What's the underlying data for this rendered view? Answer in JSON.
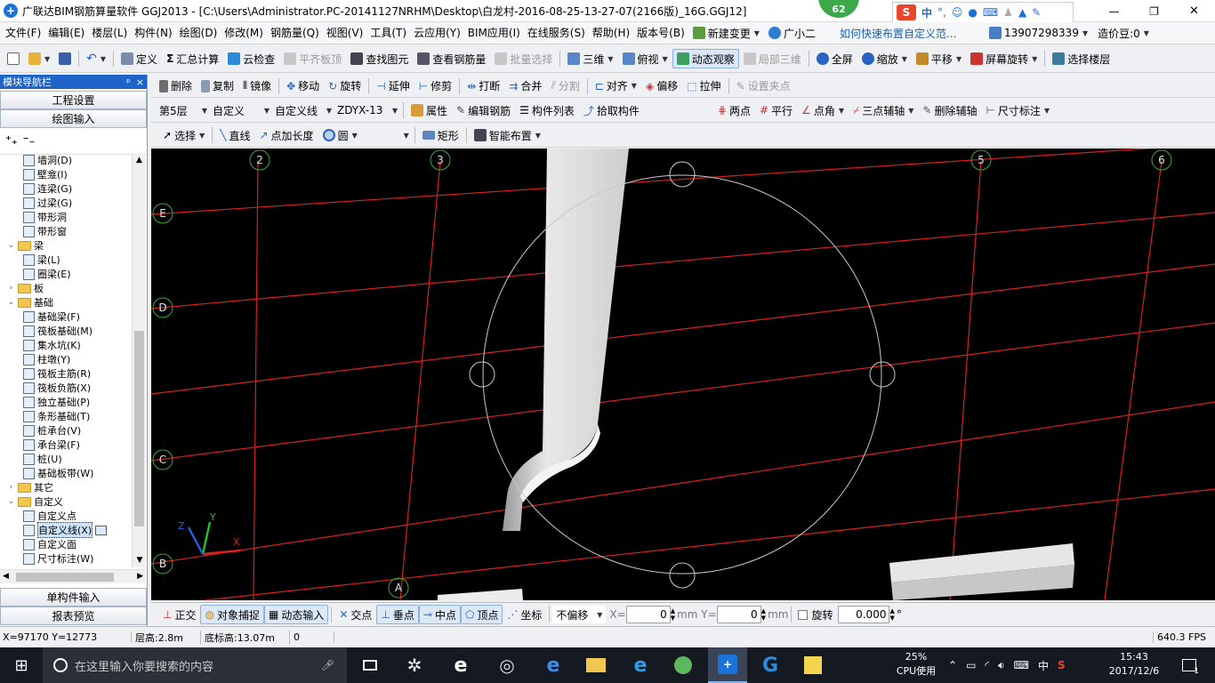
{
  "title": {
    "text": "广联达BIM钢筋算量软件 GGJ2013 - [C:\\Users\\Administrator.PC-20141127NRHM\\Desktop\\白龙村-2016-08-25-13-27-07(2166版)_16G.GGJ12]",
    "badge": "62",
    "ime_label": "中",
    "controls": {
      "min": "—",
      "restore": "❐",
      "close": "✕"
    }
  },
  "menu": {
    "items": [
      "文件(F)",
      "编辑(E)",
      "楼层(L)",
      "构件(N)",
      "绘图(D)",
      "修改(M)",
      "钢筋量(Q)",
      "视图(V)",
      "工具(T)",
      "云应用(Y)",
      "BIM应用(I)",
      "在线服务(S)",
      "帮助(H)",
      "版本号(B)"
    ],
    "new_change": "新建变更",
    "assistant": "广小二",
    "promo": "如何快速布置自定义范...",
    "phone": "13907298339",
    "price_label": "造价豆:0"
  },
  "toolbar1": {
    "define": "定义",
    "sum": "汇总计算",
    "cloud_check": "云检查",
    "flush_slab": "平齐板顶",
    "find": "查找图元",
    "view_rebar": "查看钢筋量",
    "batch_select": "批量选择",
    "view3d": "三维",
    "top_view": "俯视",
    "dynamic": "动态观察",
    "local3d": "局部三维",
    "fullscreen": "全屏",
    "zoom": "缩放",
    "pan": "平移",
    "rotate_screen": "屏幕旋转",
    "select_floor": "选择楼层"
  },
  "toolbar2": {
    "delete": "删除",
    "copy": "复制",
    "mirror": "镜像",
    "move": "移动",
    "rotate": "旋转",
    "extend": "延伸",
    "trim": "修剪",
    "break": "打断",
    "merge": "合并",
    "split": "分割",
    "align": "对齐",
    "offset": "偏移",
    "stretch": "拉伸",
    "set_clamp": "设置夹点"
  },
  "toolbar3": {
    "floor": "第5层",
    "category": "自定义",
    "type": "自定义线",
    "element": "ZDYX-13",
    "props": "属性",
    "edit_rebar": "编辑钢筋",
    "comp_list": "构件列表",
    "pick": "拾取构件",
    "two_point": "两点",
    "parallel": "平行",
    "point_angle": "点角",
    "three_point": "三点辅轴",
    "del_aux": "删除辅轴",
    "dim": "尺寸标注"
  },
  "toolbar4": {
    "select": "选择",
    "line": "直线",
    "point_len": "点加长度",
    "circle": "圆",
    "rect": "矩形",
    "smart": "智能布置"
  },
  "nav": {
    "header": "模块导航栏",
    "pin": "ᵖ",
    "close": "×",
    "btn_settings": "工程设置",
    "btn_draw": "绘图输入",
    "btn_single": "单构件输入",
    "btn_report": "报表预览",
    "tree": [
      {
        "label": "墙洞(D)",
        "indent": 2
      },
      {
        "label": "壁龛(I)",
        "indent": 2
      },
      {
        "label": "连梁(G)",
        "indent": 2
      },
      {
        "label": "过梁(G)",
        "indent": 2
      },
      {
        "label": "带形洞",
        "indent": 2
      },
      {
        "label": "带形窗",
        "indent": 2
      },
      {
        "label": "梁",
        "indent": 1,
        "folder": true,
        "open": true
      },
      {
        "label": "梁(L)",
        "indent": 2
      },
      {
        "label": "圈梁(E)",
        "indent": 2
      },
      {
        "label": "板",
        "indent": 1,
        "folder": true,
        "open": false
      },
      {
        "label": "基础",
        "indent": 1,
        "folder": true,
        "open": true
      },
      {
        "label": "基础梁(F)",
        "indent": 2
      },
      {
        "label": "筏板基础(M)",
        "indent": 2
      },
      {
        "label": "集水坑(K)",
        "indent": 2
      },
      {
        "label": "柱墩(Y)",
        "indent": 2
      },
      {
        "label": "筏板主筋(R)",
        "indent": 2
      },
      {
        "label": "筏板负筋(X)",
        "indent": 2
      },
      {
        "label": "独立基础(P)",
        "indent": 2
      },
      {
        "label": "条形基础(T)",
        "indent": 2
      },
      {
        "label": "桩承台(V)",
        "indent": 2
      },
      {
        "label": "承台梁(F)",
        "indent": 2
      },
      {
        "label": "桩(U)",
        "indent": 2
      },
      {
        "label": "基础板带(W)",
        "indent": 2
      },
      {
        "label": "其它",
        "indent": 1,
        "folder": true,
        "open": false
      },
      {
        "label": "自定义",
        "indent": 1,
        "folder": true,
        "open": true
      },
      {
        "label": "自定义点",
        "indent": 2
      },
      {
        "label": "自定义线(X)",
        "indent": 2,
        "selected": true
      },
      {
        "label": "自定义面",
        "indent": 2
      },
      {
        "label": "尺寸标注(W)",
        "indent": 2
      }
    ]
  },
  "axes": {
    "v": [
      "2",
      "3",
      "5",
      "6"
    ],
    "h": [
      "E",
      "D",
      "C",
      "B",
      "A"
    ]
  },
  "axis_labels": {
    "x": "X",
    "y": "Y",
    "z": "Z"
  },
  "bottombar": {
    "ortho": "正交",
    "snap": "对象捕捉",
    "dyn_input": "动态输入",
    "intersect": "交点",
    "perp": "垂点",
    "mid": "中点",
    "vertex": "顶点",
    "coord": "坐标",
    "offset_mode": "不偏移",
    "x_label": "X=",
    "x_val": "0",
    "y_label": "mm Y=",
    "y_val": "0",
    "mm": "mm",
    "rotate": "旋转",
    "rot_val": "0.000",
    "deg": "°"
  },
  "status": {
    "coords": "X=97170 Y=12773",
    "floor_h": "层高:2.8m",
    "base_h": "底标高:13.07m",
    "zero": "0",
    "fps": "640.3 FPS"
  },
  "taskbar": {
    "search": "在这里输入你要搜索的内容",
    "cpu_pct": "25%",
    "cpu_label": "CPU使用",
    "lang": "中",
    "time": "15:43",
    "date": "2017/12/6",
    "notif": "1"
  }
}
